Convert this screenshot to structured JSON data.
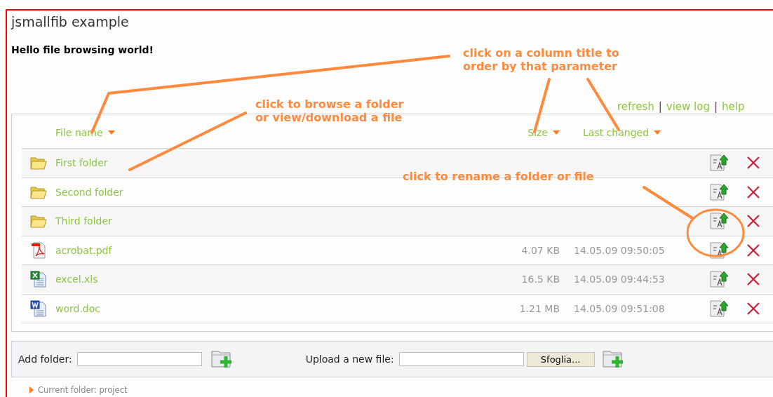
{
  "window": {
    "title": "jsmallfib example"
  },
  "heading": "Hello file browsing world!",
  "toolbar": [
    {
      "kind": "link",
      "text": "refresh"
    },
    {
      "kind": "separator",
      "text": "|"
    },
    {
      "kind": "link",
      "text": "view log"
    },
    {
      "kind": "separator",
      "text": "|"
    },
    {
      "kind": "link",
      "text": "help"
    }
  ],
  "table": {
    "columns": [
      {
        "label": "File name"
      },
      {
        "label": "Size"
      },
      {
        "label": "Last changed"
      }
    ],
    "rows": [
      {
        "kind": "folder",
        "name": "First folder"
      },
      {
        "kind": "folder",
        "name": "Second folder"
      },
      {
        "kind": "folder",
        "name": "Third folder"
      },
      {
        "kind": "pdf",
        "name": "acrobat.pdf",
        "size": "4.07 KB",
        "changed": "14.05.09 09:50:05"
      },
      {
        "kind": "xls",
        "name": "excel.xls",
        "size": "16.5 KB",
        "changed": "14.05.09 09:44:53"
      },
      {
        "kind": "doc",
        "name": "word.doc",
        "size": "1.21 MB",
        "changed": "14.05.09 09:51:08"
      }
    ]
  },
  "add_folder": {
    "label": "Add folder:"
  },
  "upload": {
    "label": "Upload a new file:",
    "browse_button": "Sfoglia..."
  },
  "current_folder": "Current folder: project",
  "annotations": [
    {
      "lines": [
        "click on a column title to",
        "order by that parameter"
      ]
    },
    {
      "lines": [
        "click to browse a folder",
        "or view/download a file"
      ]
    },
    {
      "lines": [
        "click to rename a folder or file"
      ]
    }
  ]
}
